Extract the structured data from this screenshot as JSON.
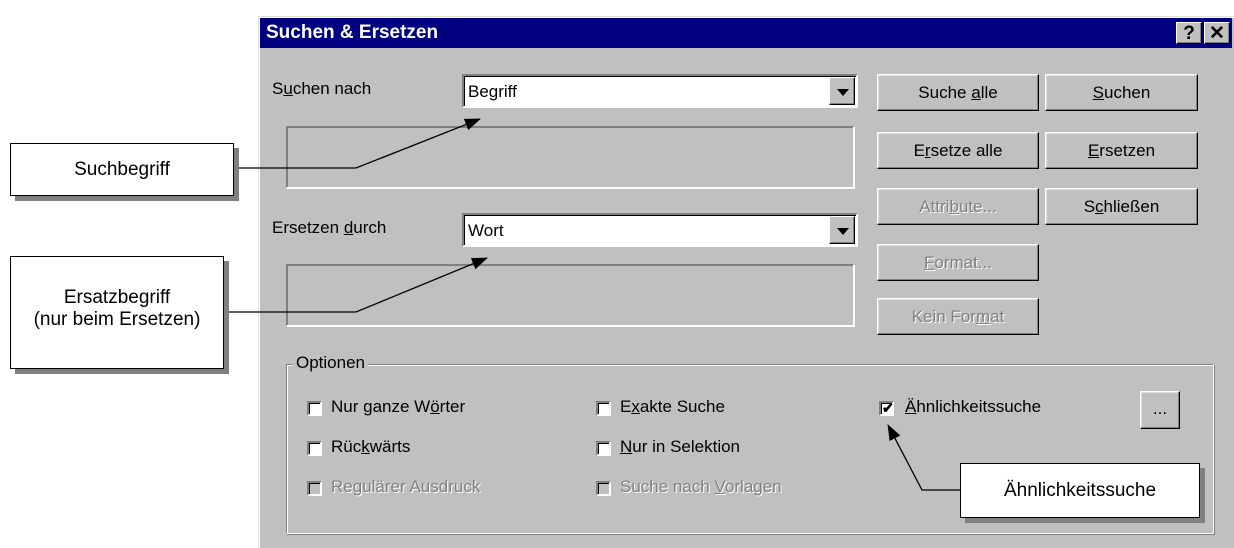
{
  "dialog": {
    "title": "Suchen & Ersetzen",
    "help_button": "?",
    "close_button": "✕"
  },
  "search": {
    "label_pre": "S",
    "label_ul": "u",
    "label_post": "chen nach",
    "value": "Begriff"
  },
  "replace": {
    "label_pre": "Ersetzen ",
    "label_ul": "d",
    "label_post": "urch",
    "value": "Wort"
  },
  "buttons": {
    "find_all": {
      "pre": "Suche ",
      "ul": "a",
      "post": "lle"
    },
    "find": {
      "pre": "",
      "ul": "S",
      "post": "uchen"
    },
    "replace_all": {
      "pre": "E",
      "ul": "r",
      "post": "setze alle"
    },
    "replace": {
      "pre": "",
      "ul": "E",
      "post": "rsetzen"
    },
    "attributes": {
      "pre": "Attri",
      "ul": "b",
      "post": "ute..."
    },
    "close": {
      "pre": "S",
      "ul": "c",
      "post": "hließen"
    },
    "format": {
      "pre": "",
      "ul": "F",
      "post": "ormat..."
    },
    "no_format": {
      "pre": "Kein For",
      "ul": "m",
      "post": "at"
    },
    "options_more": "..."
  },
  "options": {
    "title": "Optionen",
    "whole_words": {
      "pre": "Nur ganze W",
      "ul": "ö",
      "post": "rter",
      "checked": false
    },
    "backwards": {
      "pre": "Rüc",
      "ul": "k",
      "post": "wärts",
      "checked": false
    },
    "regex": {
      "pre": "Re",
      "ul": "g",
      "post": "ulärer Ausdruck",
      "checked": false,
      "disabled": true
    },
    "exact": {
      "pre": "E",
      "ul": "x",
      "post": "akte Suche",
      "checked": false
    },
    "selection_only": {
      "pre": "",
      "ul": "N",
      "post": "ur in Selektion",
      "checked": false
    },
    "styles": {
      "pre": "Suche nach ",
      "ul": "V",
      "post": "orlagen",
      "checked": false,
      "disabled": true
    },
    "similarity": {
      "pre": "",
      "ul": "Ä",
      "post": "hnlichkeitssuche",
      "checked": true
    },
    "check_mark": "✔"
  },
  "callouts": {
    "search_term": "Suchbegriff",
    "replace_term_line1": "Ersatzbegriff",
    "replace_term_line2": "(nur beim Ersetzen)",
    "similarity": "Ähnlichkeitssuche"
  }
}
